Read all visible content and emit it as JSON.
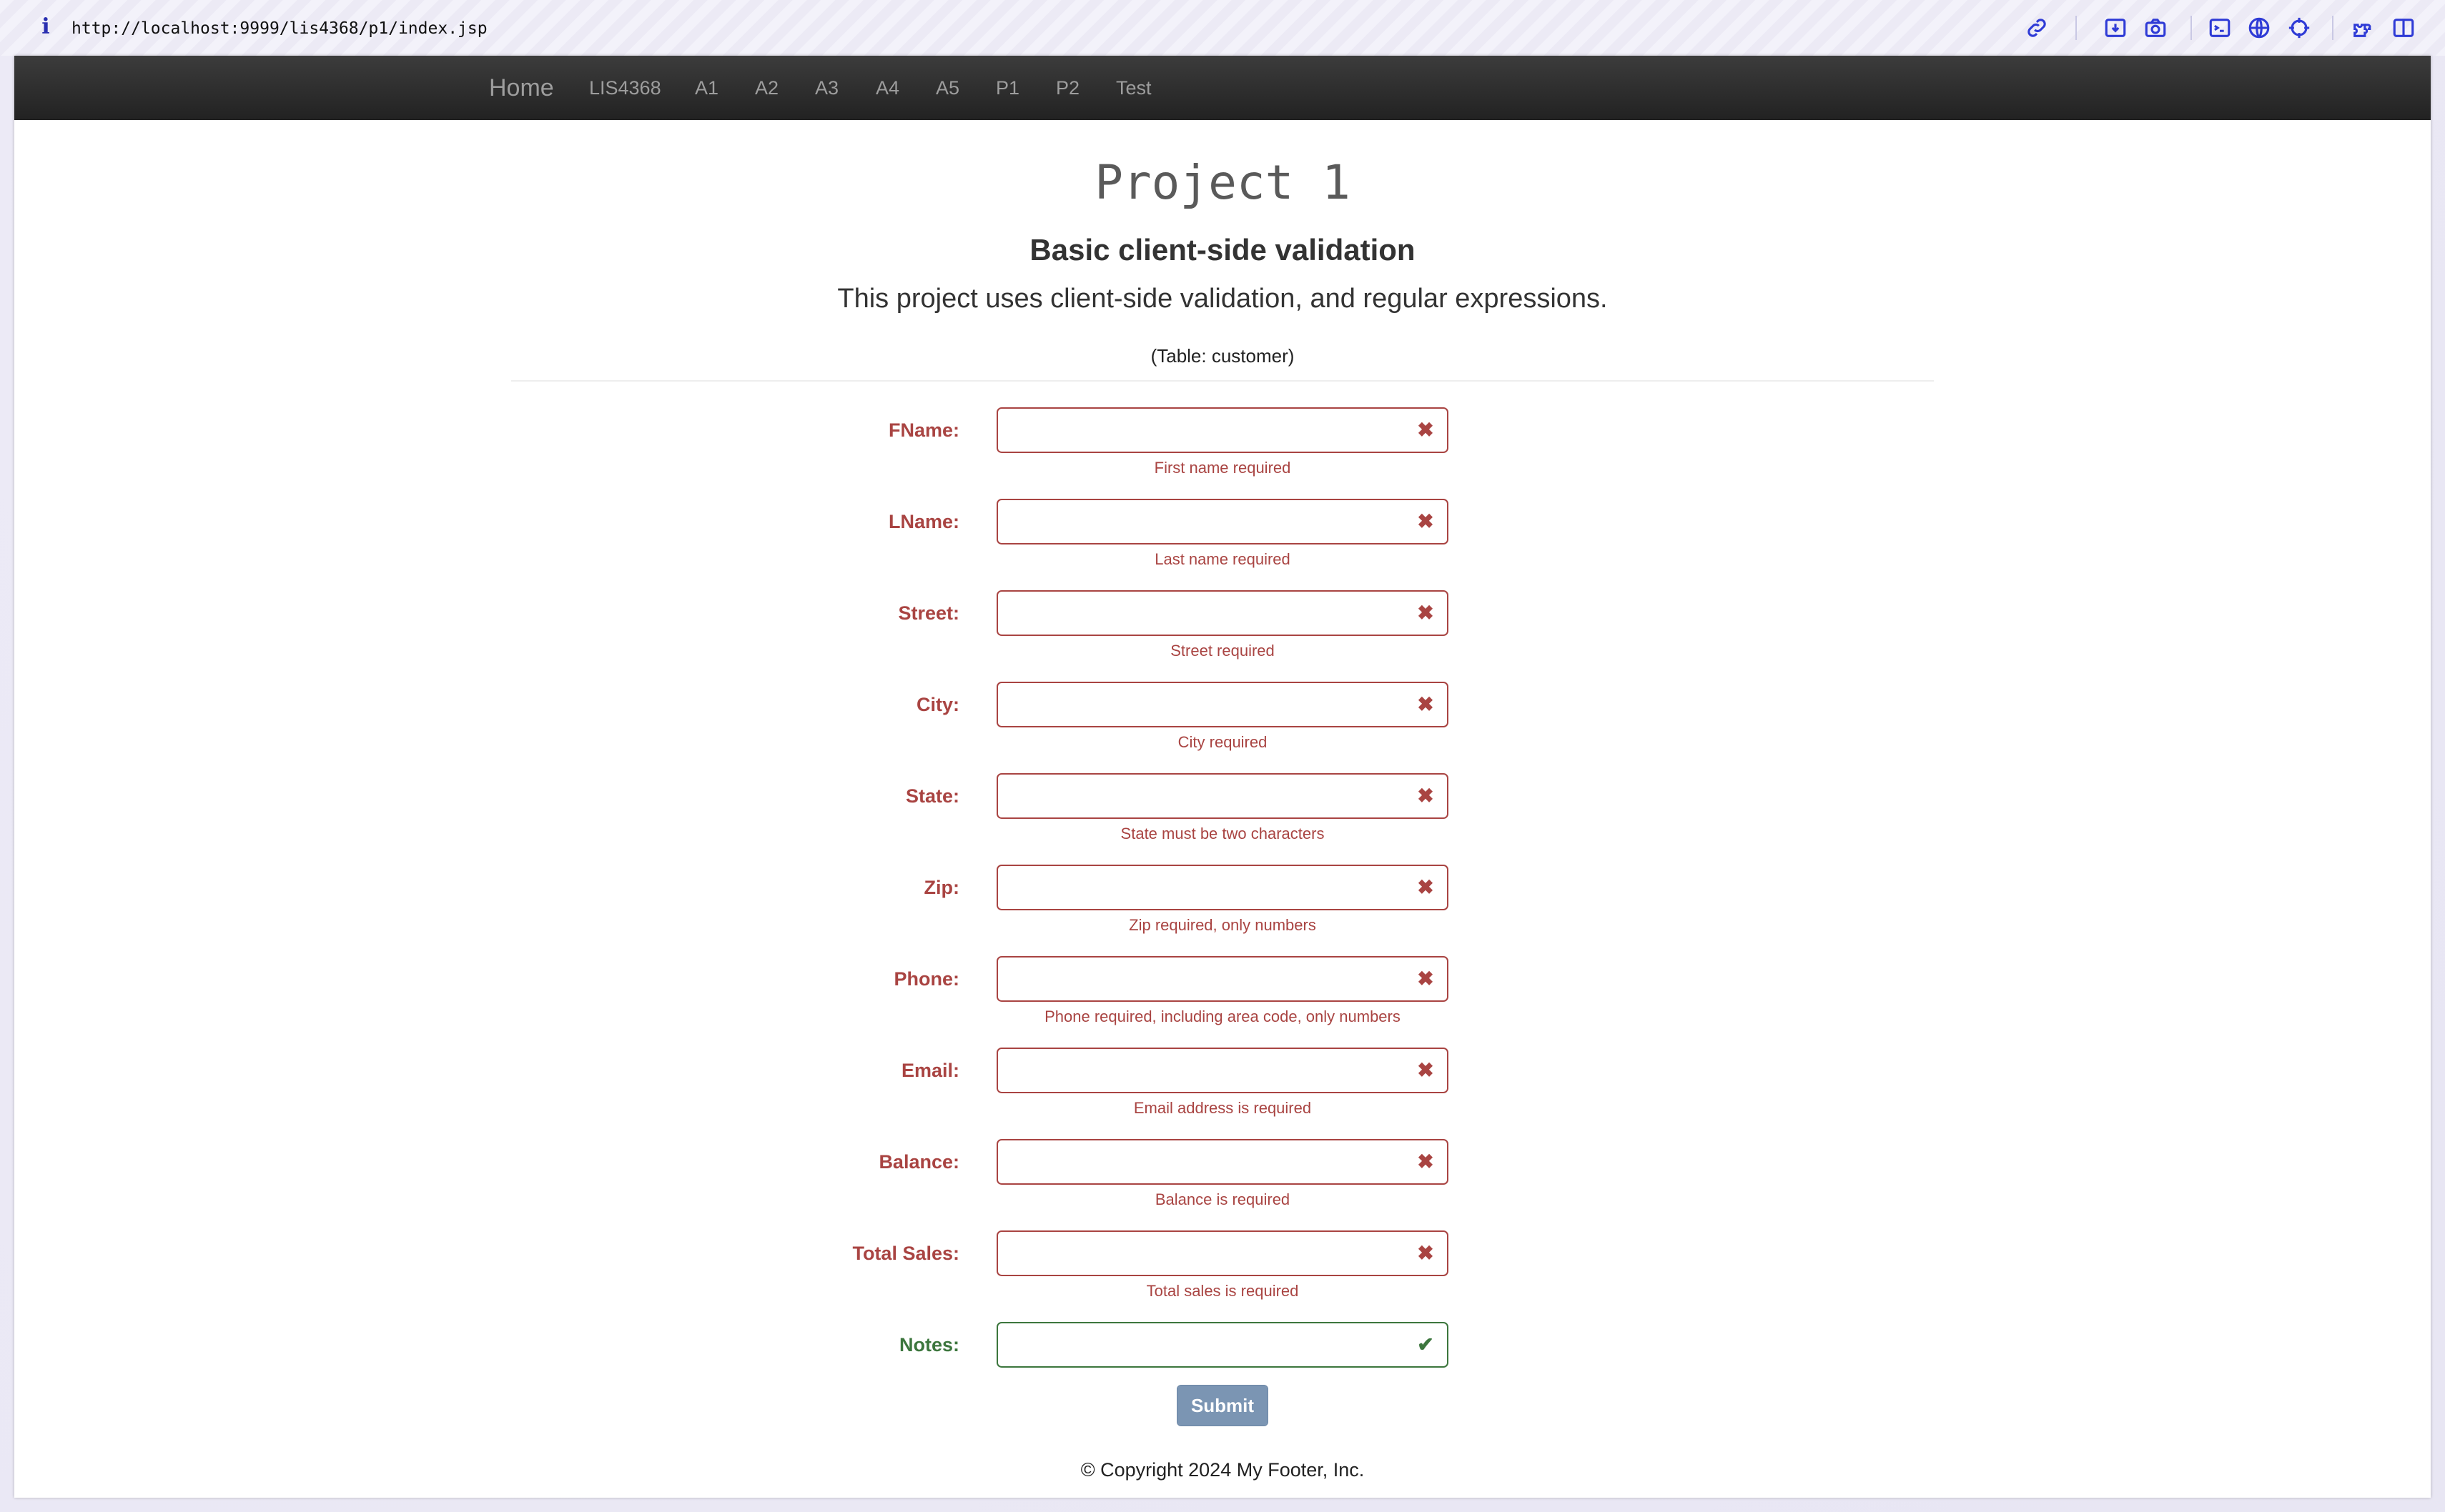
{
  "browser": {
    "info_icon": "i",
    "url": "http://localhost:9999/lis4368/p1/index.jsp",
    "toolbar_icons": [
      "link-icon",
      "download-icon",
      "camera-icon",
      "terminal-icon",
      "globe-icon",
      "crosshair-icon",
      "extension-icon",
      "split-view-icon"
    ]
  },
  "navbar": {
    "brand": "Home",
    "items": [
      "LIS4368",
      "A1",
      "A2",
      "A3",
      "A4",
      "A5",
      "P1",
      "P2",
      "Test"
    ]
  },
  "page": {
    "title": "Project 1",
    "heading": "Basic client-side validation",
    "lead": "This project uses client-side validation, and regular expressions.",
    "table_note": "(Table: customer)"
  },
  "form": {
    "fields": [
      {
        "label": "FName:",
        "value": "",
        "state": "error",
        "help": "First name required"
      },
      {
        "label": "LName:",
        "value": "",
        "state": "error",
        "help": "Last name required"
      },
      {
        "label": "Street:",
        "value": "",
        "state": "error",
        "help": "Street required"
      },
      {
        "label": "City:",
        "value": "",
        "state": "error",
        "help": "City required"
      },
      {
        "label": "State:",
        "value": "",
        "state": "error",
        "help": "State must be two characters"
      },
      {
        "label": "Zip:",
        "value": "",
        "state": "error",
        "help": "Zip required, only numbers"
      },
      {
        "label": "Phone:",
        "value": "",
        "state": "error",
        "help": "Phone required, including area code, only numbers"
      },
      {
        "label": "Email:",
        "value": "",
        "state": "error",
        "help": "Email address is required"
      },
      {
        "label": "Balance:",
        "value": "",
        "state": "error",
        "help": "Balance is required"
      },
      {
        "label": "Total Sales:",
        "value": "",
        "state": "error",
        "help": "Total sales is required"
      },
      {
        "label": "Notes:",
        "value": "",
        "state": "success",
        "help": ""
      }
    ],
    "error_glyph": "✖",
    "success_glyph": "✔",
    "submit_label": "Submit"
  },
  "footer": {
    "text": "© Copyright 2024 My Footer, Inc."
  },
  "colors": {
    "error": "#a94442",
    "success": "#3c763d",
    "navbar": "#222222",
    "submit": "#7b95b3"
  }
}
